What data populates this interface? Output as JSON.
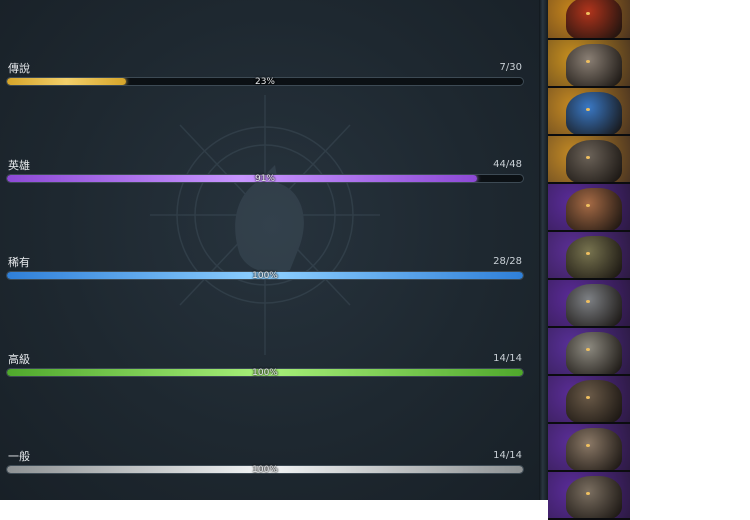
{
  "rarities": [
    {
      "label": "傳說",
      "count": "7/30",
      "percent_text": "23%",
      "fill": 0.23,
      "color": "#d6a52a",
      "highlight": "#f2cf6a"
    },
    {
      "label": "英雄",
      "count": "44/48",
      "percent_text": "91%",
      "fill": 0.91,
      "color": "#8d4ad6",
      "highlight": "#c896ff"
    },
    {
      "label": "稀有",
      "count": "28/28",
      "percent_text": "100%",
      "fill": 1.0,
      "color": "#2f7fd8",
      "highlight": "#8ed0ff"
    },
    {
      "label": "高級",
      "count": "14/14",
      "percent_text": "100%",
      "fill": 1.0,
      "color": "#4fa82c",
      "highlight": "#a8f07a"
    },
    {
      "label": "一般",
      "count": "14/14",
      "percent_text": "100%",
      "fill": 1.0,
      "color": "#8e9294",
      "highlight": "#f2f4f5"
    }
  ],
  "portraits": [
    {
      "tier": "legendary",
      "bg": "#c7861c",
      "creature": "#b0341c"
    },
    {
      "tier": "legendary",
      "bg": "#c8901f",
      "creature": "#8a7f74"
    },
    {
      "tier": "legendary",
      "bg": "#c58a22",
      "creature": "#3a78c4"
    },
    {
      "tier": "legendary",
      "bg": "#c38a25",
      "creature": "#6b6258"
    },
    {
      "tier": "epic",
      "bg": "#5a2c9a",
      "creature": "#a56a45"
    },
    {
      "tier": "epic",
      "bg": "#5b2f96",
      "creature": "#77734f"
    },
    {
      "tier": "epic",
      "bg": "#5a2b98",
      "creature": "#7d8084"
    },
    {
      "tier": "epic",
      "bg": "#59309a",
      "creature": "#8d8a80"
    },
    {
      "tier": "epic",
      "bg": "#5a2d97",
      "creature": "#6a5a48"
    },
    {
      "tier": "epic",
      "bg": "#5b2e99",
      "creature": "#8a7866"
    },
    {
      "tier": "epic",
      "bg": "#5a2c9a",
      "creature": "#7a6e60"
    }
  ]
}
